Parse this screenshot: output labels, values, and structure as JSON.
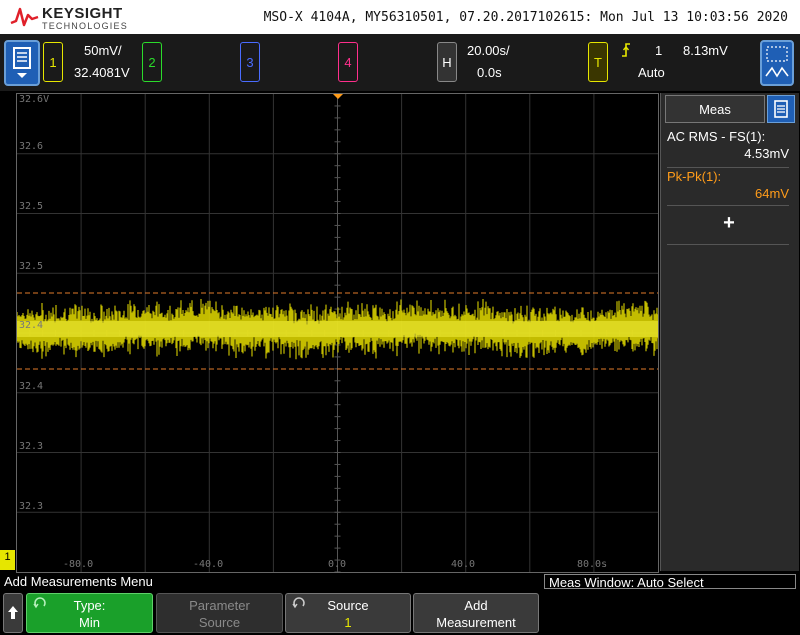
{
  "header": {
    "brand": "KEYSIGHT",
    "sub": "TECHNOLOGIES",
    "info": "MSO-X 4104A, MY56310501, 07.20.2017102615: Mon Jul 13 10:03:56 2020"
  },
  "topbar": {
    "ch1": {
      "label": "1",
      "scale": "50mV/",
      "offset": "32.4081V",
      "color": "#e6e600"
    },
    "ch2": {
      "label": "2",
      "color": "#2bdc2b"
    },
    "ch3": {
      "label": "3",
      "color": "#4a6cff"
    },
    "ch4": {
      "label": "4",
      "color": "#ff2f8c"
    },
    "h": {
      "label": "H",
      "time": "20.00s/",
      "delay": "0.0s"
    },
    "t": {
      "label": "T",
      "source": "1",
      "level": "8.13mV",
      "mode": "Auto"
    }
  },
  "plot": {
    "y_labels": [
      "32.6V",
      "32.6",
      "32.5",
      "32.5",
      "32.4",
      "32.4",
      "32.3",
      "32.3"
    ],
    "x_labels": [
      "-80.0",
      "-40.0",
      "0.0",
      "40.0",
      "80.0s"
    ],
    "ch_marker": "1"
  },
  "panel": {
    "tab": "Meas",
    "m1_label": "AC RMS - FS(1):",
    "m1_value": "4.53mV",
    "m2_label": "Pk-Pk(1):",
    "m2_value": "64mV",
    "add": "+"
  },
  "status": {
    "left": "Add Measurements Menu",
    "right": "Meas Window: Auto Select"
  },
  "softkeys": {
    "type_l1": "Type:",
    "type_l2": "Min",
    "param_l1": "Parameter",
    "param_l2": "Source",
    "source_l1": "Source",
    "source_l2": "1",
    "add_l1": "Add",
    "add_l2": "Measurement"
  }
}
